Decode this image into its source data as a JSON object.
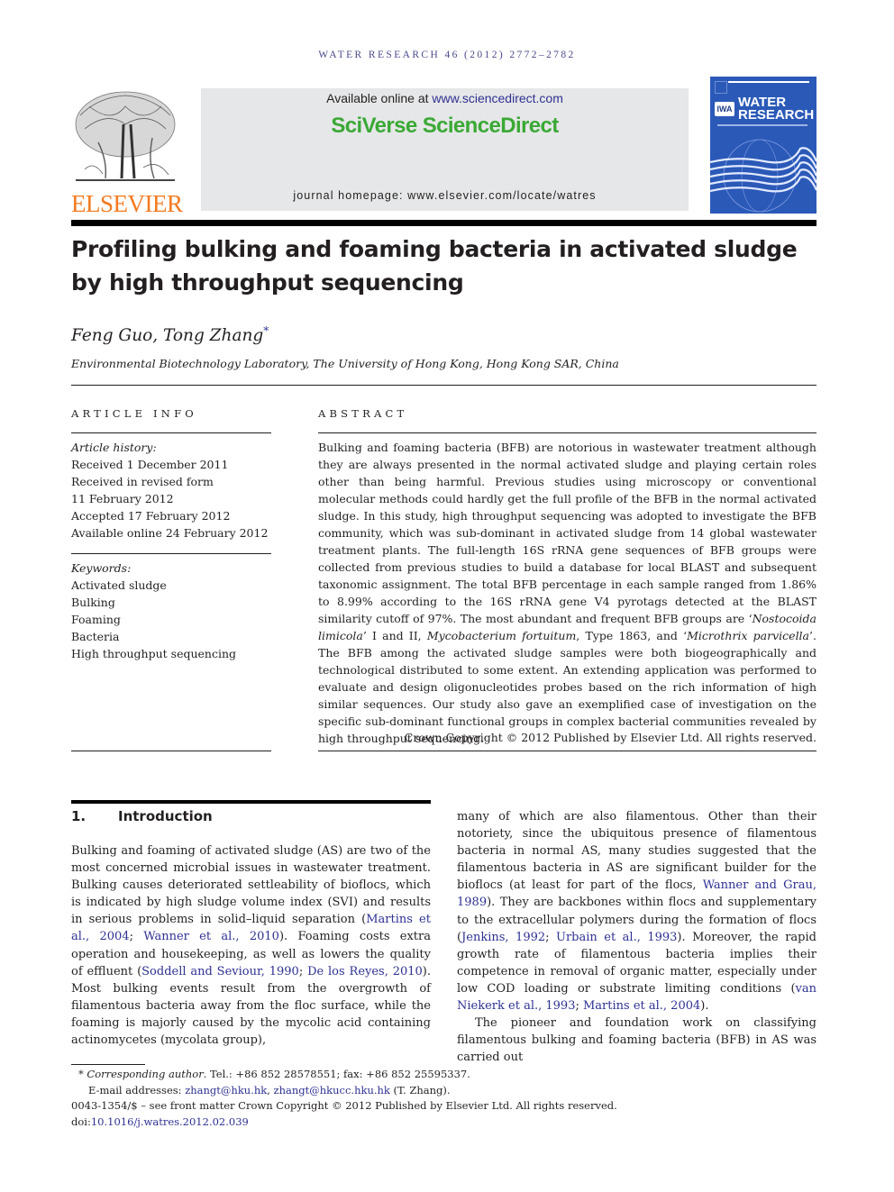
{
  "running_head": "WATER RESEARCH 46 (2012) 2772–2782",
  "header": {
    "publisher_logo_text": "ELSEVIER",
    "available_prefix": "Available online at ",
    "available_link": "www.sciencedirect.com",
    "platform_name": "SciVerse ScienceDirect",
    "journal_homepage": "journal homepage: www.elsevier.com/locate/watres",
    "cover": {
      "badge": "IWA",
      "title_line1": "WATER",
      "title_line2": "RESEARCH"
    }
  },
  "article": {
    "title_line1": "Profiling bulking and foaming bacteria in activated sludge",
    "title_line2": "by high throughput sequencing",
    "authors": "Feng Guo, Tong Zhang",
    "corresponding_mark": "*",
    "affiliation": "Environmental Biotechnology Laboratory, The University of Hong Kong, Hong Kong SAR, China"
  },
  "article_info": {
    "heading": "ARTICLE INFO",
    "history_label": "Article history:",
    "history": [
      "Received 1 December 2011",
      "Received in revised form",
      "11 February 2012",
      "Accepted 17 February 2012",
      "Available online 24 February 2012"
    ],
    "keywords_label": "Keywords:",
    "keywords": [
      "Activated sludge",
      "Bulking",
      "Foaming",
      "Bacteria",
      "High throughput sequencing"
    ]
  },
  "abstract": {
    "heading": "ABSTRACT",
    "p1": "Bulking and foaming bacteria (BFB) are notorious in wastewater treatment although they are always presented in the normal activated sludge and playing certain roles other than being harmful. Previous studies using microscopy or conventional molecular methods could hardly get the full profile of the BFB in the normal activated sludge. In this study, high throughput sequencing was adopted to investigate the BFB community, which was sub-dominant in activated sludge from 14 global wastewater treatment plants. The full-length 16S rRNA gene sequences of BFB groups were collected from previous studies to build a database for local BLAST and subsequent taxonomic assignment. The total BFB percentage in each sample ranged from 1.86% to 8.99% according to the 16S rRNA gene V4 pyrotags detected at the BLAST similarity cutoff of 97%. The most abundant and frequent BFB groups are ‘",
    "sp1": "Nostocoida limicola",
    "p2": "’ I and II, ",
    "sp2": "Mycobacterium fortuitum",
    "p3": ", Type 1863, and ‘",
    "sp3": "Microthrix parvicella",
    "p4": "’. The BFB among the activated sludge samples were both biogeographically and technological distributed to some extent. An extending application was performed to evaluate and design oligonucleotides probes based on the rich information of high similar sequences. Our study also gave an exemplified case of investigation on the specific sub-dominant functional groups in complex bacterial communities revealed by high throughput sequencing.",
    "copyright": "Crown Copyright © 2012 Published by Elsevier Ltd. All rights reserved."
  },
  "introduction": {
    "number": "1.",
    "heading": "Introduction",
    "left": {
      "t1": "Bulking and foaming of activated sludge (AS) are two of the most concerned microbial issues in wastewater treatment. Bulking causes deteriorated settleability of bioflocs, which is indicated by high sludge volume index (SVI) and results in serious problems in solid–liquid separation (",
      "c1": "Martins et al., 2004",
      "t2": "; ",
      "c2": "Wanner et al., 2010",
      "t3": "). Foaming costs extra operation and housekeeping, as well as lowers the quality of effluent (",
      "c3": "Soddell and Seviour, 1990",
      "t4": "; ",
      "c4": "De los Reyes, 2010",
      "t5": "). Most bulking events result from the overgrowth of filamentous bacteria away from the floc surface, while the foaming is majorly caused by the mycolic acid containing actinomycetes (mycolata group),"
    },
    "right": {
      "t1": "many of which are also filamentous. Other than their notoriety, since the ubiquitous presence of filamentous bacteria in normal AS, many studies suggested that the filamentous bacteria in AS are significant builder for the bioflocs (at least for part of the flocs, ",
      "c1": "Wanner and Grau, 1989",
      "t2": "). They are backbones within flocs and supplementary to the extracellular polymers during the formation of flocs (",
      "c2": "Jenkins, 1992",
      "t3": "; ",
      "c3": "Urbain et al., 1993",
      "t4": "). Moreover, the rapid growth rate of filamentous bacteria implies their competence in removal of organic matter, especially under low COD loading or substrate limiting conditions (",
      "c4": "van Niekerk et al., 1993",
      "t5": "; ",
      "c5": "Martins et al., 2004",
      "t6": ").",
      "p2": "The pioneer and foundation work on classifying filamentous bulking and foaming bacteria (BFB) in AS was carried out"
    }
  },
  "footnotes": {
    "mark": "*",
    "corr_label": "Corresponding author",
    "contact": ". Tel.: +86 852 28578551; fax: +86 852 25595337.",
    "email_label": "E-mail addresses: ",
    "email1": "zhangt@hku.hk",
    "email_sep": ", ",
    "email2": "zhangt@hkucc.hku.hk",
    "email_suffix": " (T. Zhang).",
    "issn_line": "0043-1354/$ – see front matter Crown Copyright © 2012 Published by Elsevier Ltd. All rights reserved.",
    "doi_label": "doi:",
    "doi": "10.1016/j.watres.2012.02.039"
  },
  "colors": {
    "link": "#2e3192",
    "sciverse_green": "#3aa935",
    "elsevier_orange": "#f47a20",
    "cover_blue": "#2b59b8",
    "panel_grey": "#e6e7e8"
  }
}
